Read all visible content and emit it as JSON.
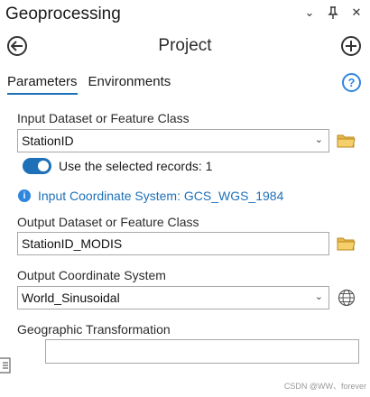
{
  "pane": {
    "title": "Geoprocessing"
  },
  "tool": {
    "name": "Project"
  },
  "tabs": [
    {
      "label": "Parameters",
      "active": true
    },
    {
      "label": "Environments",
      "active": false
    }
  ],
  "params": {
    "input_label": "Input Dataset or Feature Class",
    "input_value": "StationID",
    "toggle_label": "Use the selected records: 1",
    "toggle_on": true,
    "input_cs_info": "Input Coordinate System: GCS_WGS_1984",
    "output_label": "Output Dataset or Feature Class",
    "output_value": "StationID_MODIS",
    "output_cs_label": "Output Coordinate System",
    "output_cs_value": "World_Sinusoidal",
    "geo_transform_label": "Geographic Transformation",
    "geo_transform_value": ""
  },
  "watermark": "CSDN @WW、forever",
  "colors": {
    "accent": "#1e70b8",
    "info": "#2e86de",
    "folder": "#e8b84a"
  }
}
